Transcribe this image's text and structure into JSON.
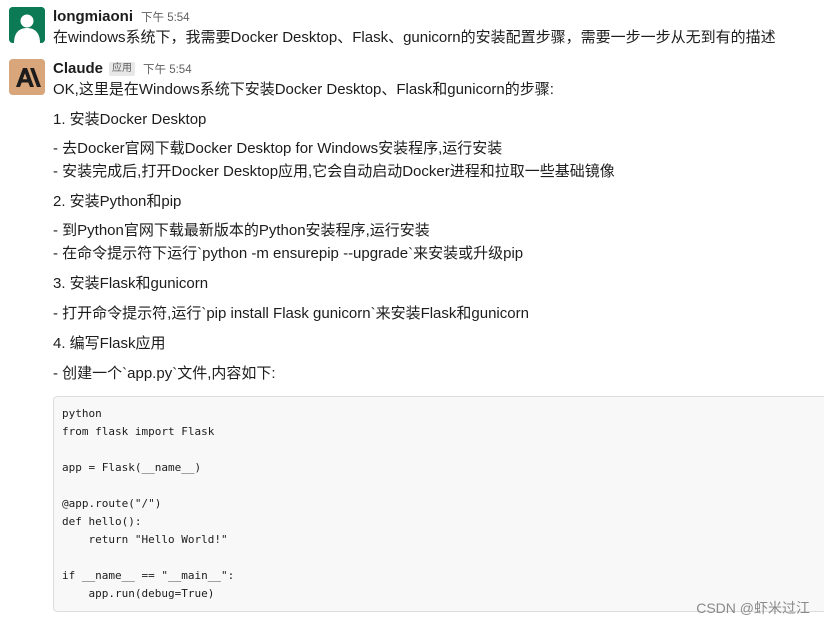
{
  "messages": {
    "user": {
      "name": "longmiaoni",
      "time": "下午 5:54",
      "text": "在windows系统下，我需要Docker Desktop、Flask、gunicorn的安装配置步骤，需要一步一步从无到有的描述",
      "avatar_color": "#0b7a55"
    },
    "claude": {
      "name": "Claude",
      "badge": "应用",
      "time": "下午 5:54",
      "avatar_color": "#d9a57a",
      "lines": [
        "OK,这里是在Windows系统下安装Docker Desktop、Flask和gunicorn的步骤:",
        "1. 安装Docker Desktop",
        "- 去Docker官网下载Docker Desktop for Windows安装程序,运行安装",
        "- 安装完成后,打开Docker Desktop应用,它会自动启动Docker进程和拉取一些基础镜像",
        "2. 安装Python和pip",
        "- 到Python官网下载最新版本的Python安装程序,运行安装",
        "- 在命令提示符下运行`python -m ensurepip --upgrade`来安装或升级pip",
        "3. 安装Flask和gunicorn",
        "- 打开命令提示符,运行`pip install Flask gunicorn`来安装Flask和gunicorn",
        "4. 编写Flask应用",
        "- 创建一个`app.py`文件,内容如下:"
      ],
      "code": [
        "python",
        "from flask import Flask",
        "",
        "app = Flask(__name__)",
        "",
        "@app.route(\"/\")",
        "def hello():",
        "    return \"Hello World!\"",
        "",
        "if __name__ == \"__main__\":",
        "    app.run(debug=True)"
      ]
    }
  },
  "watermark": "CSDN @虾米过江"
}
